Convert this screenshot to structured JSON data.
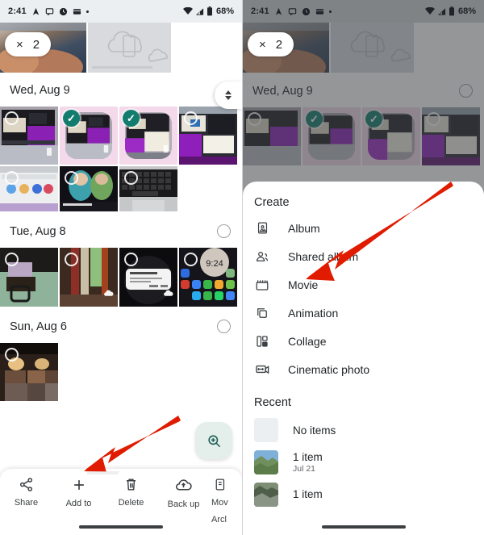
{
  "status_bar": {
    "time": "2:41",
    "battery": "68%",
    "left_icons": [
      "navigation-icon",
      "chat-icon",
      "clock-icon",
      "wallet-icon",
      "more-dot-icon"
    ],
    "right_icons": [
      "wifi-icon",
      "signal-icon",
      "battery-icon"
    ]
  },
  "left_panel": {
    "selection_pill": {
      "close": "×",
      "count": "2"
    },
    "date_headers": [
      {
        "label": "Wed, Aug 9"
      },
      {
        "label": "Tue, Aug 8"
      },
      {
        "label": "Sun, Aug 6"
      }
    ],
    "fab": {
      "icon": "zoom-in-icon"
    },
    "bottom_toolbar": [
      {
        "icon": "share-icon",
        "label": "Share"
      },
      {
        "icon": "plus-icon",
        "label": "Add to"
      },
      {
        "icon": "trash-icon",
        "label": "Delete"
      },
      {
        "icon": "backup-cloud-icon",
        "label": "Back up"
      },
      {
        "icon": "archive-icon",
        "label": "Mov",
        "label2": "Arcl"
      }
    ]
  },
  "right_panel": {
    "selection_pill": {
      "close": "×",
      "count": "2"
    },
    "date_header": "Wed, Aug 9",
    "sheet": {
      "create_title": "Create",
      "create_items": [
        {
          "icon": "album-icon",
          "label": "Album"
        },
        {
          "icon": "shared-album-icon",
          "label": "Shared album"
        },
        {
          "icon": "movie-icon",
          "label": "Movie"
        },
        {
          "icon": "animation-icon",
          "label": "Animation"
        },
        {
          "icon": "collage-icon",
          "label": "Collage"
        },
        {
          "icon": "cinematic-photo-icon",
          "label": "Cinematic photo"
        }
      ],
      "recent_title": "Recent",
      "recent_items": [
        {
          "title": "No items",
          "subtitle": ""
        },
        {
          "title": "1 item",
          "subtitle": "Jul 21"
        },
        {
          "title": "1 item",
          "subtitle": ""
        }
      ]
    }
  },
  "annotations": {
    "arrow_color": "#e01b00",
    "arrows": [
      {
        "name": "arrow-pointing-add-to"
      },
      {
        "name": "arrow-pointing-recent-album"
      }
    ]
  },
  "colors": {
    "accent_check": "#127d6e",
    "selected_tile_bg": "#f3d9ea",
    "status_bar_bg": "#eceff1",
    "scrim": "rgba(60,64,67,0.55)"
  }
}
